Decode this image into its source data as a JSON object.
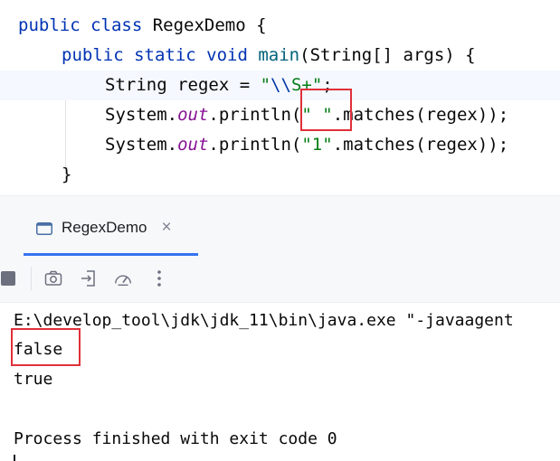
{
  "editor": {
    "lines": {
      "class_decl": {
        "kw": "public class",
        "name": " RegexDemo {"
      },
      "main_decl": {
        "kw": "public static void",
        "fn": "main",
        "rest": "(String[] args) {"
      },
      "regex_decl": {
        "pre": "String regex = ",
        "q1": "\"",
        "esc": "\\\\",
        "tail": "S+\"",
        "semi": ";"
      },
      "println1": {
        "pre": "System.",
        "field": "out",
        "mid": ".println(",
        "str": "\" \"",
        "post": ".matches(regex));"
      },
      "println2": {
        "pre": "System.",
        "field": "out",
        "mid": ".println(",
        "str": "\"1\"",
        "post": ".matches(regex));"
      },
      "close_brace": "}"
    }
  },
  "tool_window": {
    "tab_label": "RegexDemo",
    "close_glyph": "×"
  },
  "console": {
    "command": "E:\\develop_tool\\jdk\\jdk_11\\bin\\java.exe \"-javaagent",
    "output1": "false",
    "output2": "true",
    "finish": "Process finished with exit code 0"
  },
  "colors": {
    "keyword": "#0033b3",
    "method": "#00627a",
    "string": "#067d17",
    "field": "#871094",
    "highlight_box": "#e0303a",
    "tab_underline": "#3574f0"
  }
}
